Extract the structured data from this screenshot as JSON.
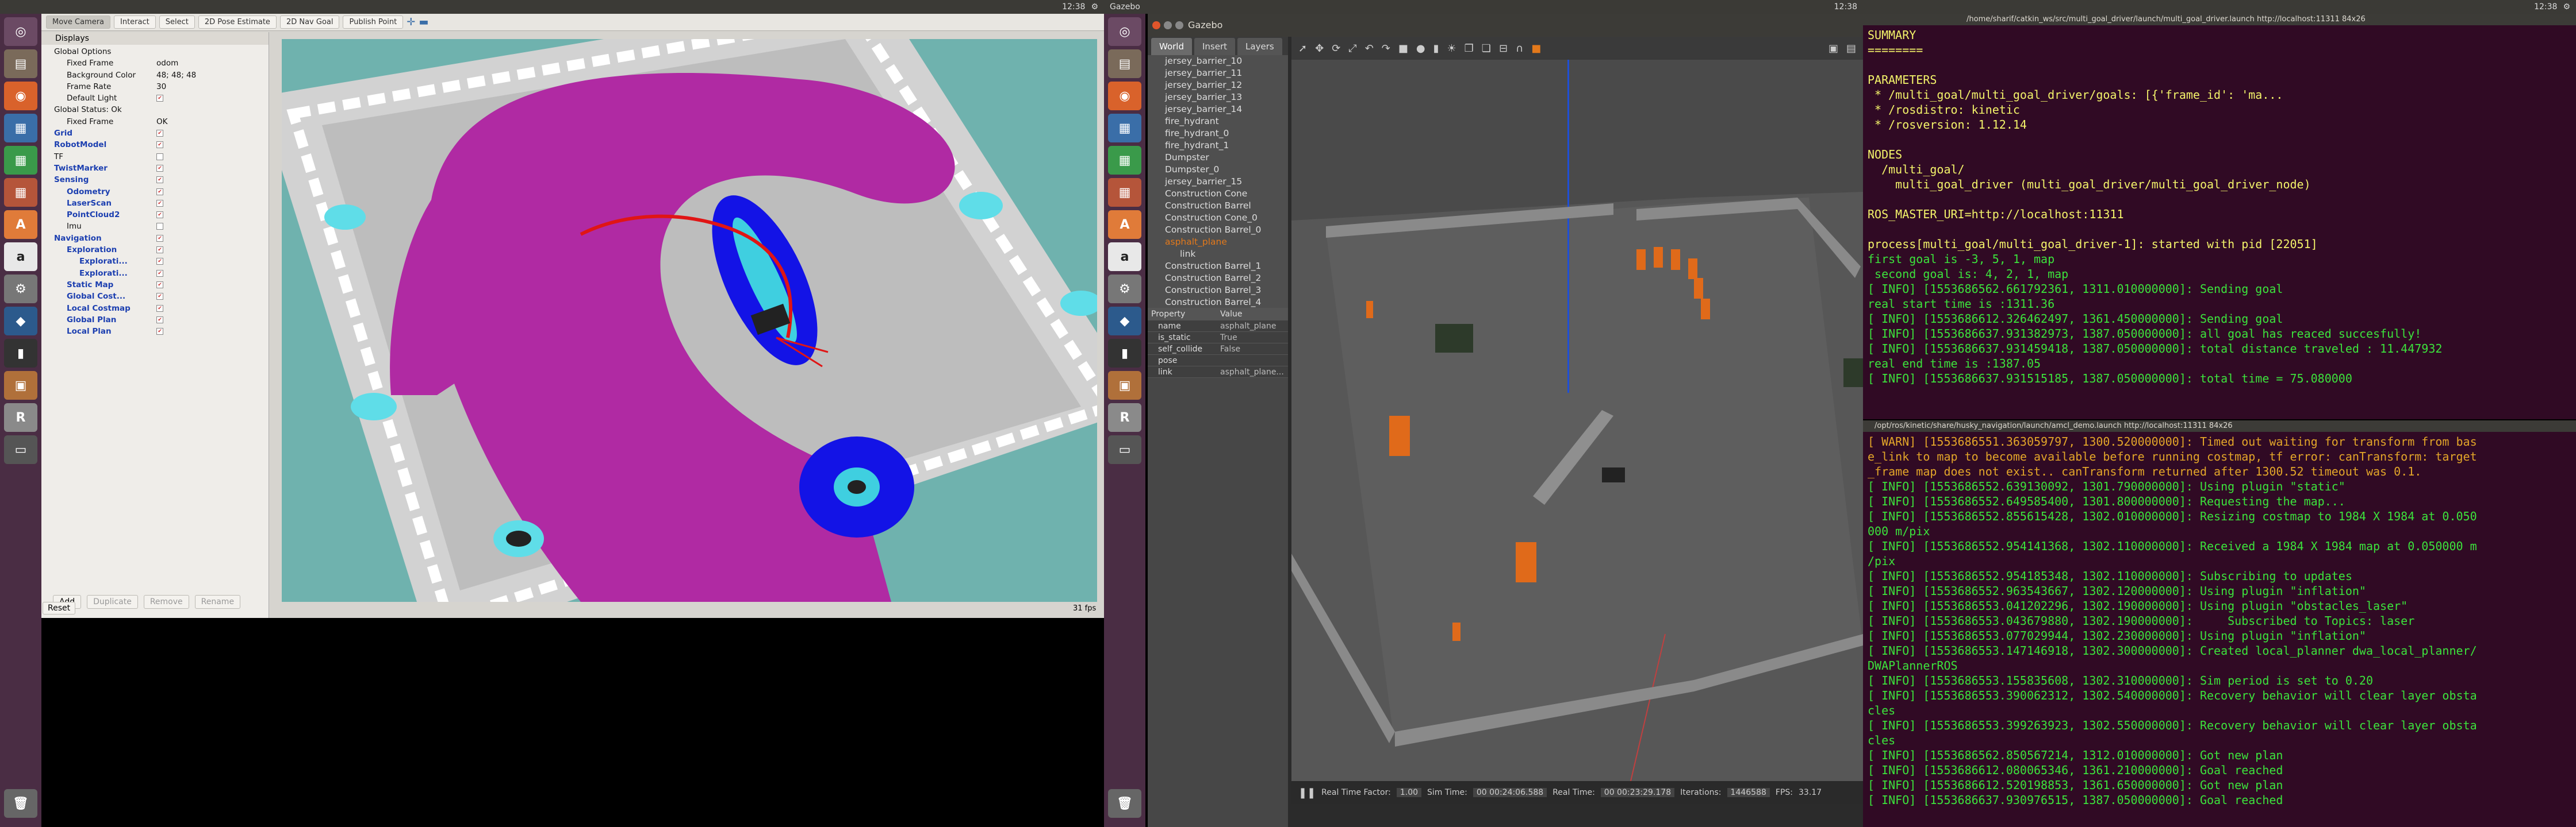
{
  "left_topbar": {
    "title": "",
    "clock": "12:38"
  },
  "mid_topbar": {
    "title": "Gazebo",
    "clock": "12:38"
  },
  "right_topbar": {
    "clock": "12:38"
  },
  "rviz": {
    "tools": [
      "Move Camera",
      "Interact",
      "Select",
      "2D Pose Estimate",
      "2D Nav Goal",
      "Publish Point"
    ],
    "displays_title": "Displays",
    "tree": [
      {
        "label": "Global Options",
        "value": "",
        "indent": 1,
        "cls": ""
      },
      {
        "label": "Fixed Frame",
        "value": "odom",
        "indent": 2,
        "cls": ""
      },
      {
        "label": "Background Color",
        "value": "48; 48; 48",
        "indent": 2,
        "cls": ""
      },
      {
        "label": "Frame Rate",
        "value": "30",
        "indent": 2,
        "cls": ""
      },
      {
        "label": "Default Light",
        "value": "",
        "indent": 2,
        "cls": "check"
      },
      {
        "label": "Global Status: Ok",
        "value": "",
        "indent": 1,
        "cls": ""
      },
      {
        "label": "Fixed Frame",
        "value": "OK",
        "indent": 2,
        "cls": ""
      },
      {
        "label": "Grid",
        "value": "",
        "indent": 1,
        "cls": "blue check"
      },
      {
        "label": "RobotModel",
        "value": "",
        "indent": 1,
        "cls": "blue check"
      },
      {
        "label": "TF",
        "value": "",
        "indent": 1,
        "cls": "box"
      },
      {
        "label": "TwistMarker",
        "value": "",
        "indent": 1,
        "cls": "blue check"
      },
      {
        "label": "Sensing",
        "value": "",
        "indent": 1,
        "cls": "blue check"
      },
      {
        "label": "Odometry",
        "value": "",
        "indent": 2,
        "cls": "blue check"
      },
      {
        "label": "LaserScan",
        "value": "",
        "indent": 2,
        "cls": "blue check"
      },
      {
        "label": "PointCloud2",
        "value": "",
        "indent": 2,
        "cls": "blue check"
      },
      {
        "label": "Imu",
        "value": "",
        "indent": 2,
        "cls": "box"
      },
      {
        "label": "Navigation",
        "value": "",
        "indent": 1,
        "cls": "blue check"
      },
      {
        "label": "Exploration",
        "value": "",
        "indent": 2,
        "cls": "blue check"
      },
      {
        "label": "Explorati...",
        "value": "",
        "indent": 3,
        "cls": "blue check"
      },
      {
        "label": "Explorati...",
        "value": "",
        "indent": 3,
        "cls": "blue check"
      },
      {
        "label": "Static Map",
        "value": "",
        "indent": 2,
        "cls": "blue check"
      },
      {
        "label": "Global Cost...",
        "value": "",
        "indent": 2,
        "cls": "blue check"
      },
      {
        "label": "Local Costmap",
        "value": "",
        "indent": 2,
        "cls": "blue check"
      },
      {
        "label": "Global Plan",
        "value": "",
        "indent": 2,
        "cls": "blue check"
      },
      {
        "label": "Local Plan",
        "value": "",
        "indent": 2,
        "cls": "blue check"
      }
    ],
    "buttons": {
      "add": "Add",
      "duplicate": "Duplicate",
      "remove": "Remove",
      "rename": "Rename",
      "reset": "Reset"
    },
    "fps": "31 fps"
  },
  "gazebo": {
    "title": "Gazebo",
    "tabs": [
      "World",
      "Insert",
      "Layers"
    ],
    "models": [
      "jersey_barrier_10",
      "jersey_barrier_11",
      "jersey_barrier_12",
      "jersey_barrier_13",
      "jersey_barrier_14",
      "fire_hydrant",
      "fire_hydrant_0",
      "fire_hydrant_1",
      "Dumpster",
      "Dumpster_0",
      "jersey_barrier_15",
      "Construction Cone",
      "Construction Barrel",
      "Construction Cone_0",
      "Construction Barrel_0",
      "Construction Barrel_1",
      "Construction Barrel_2",
      "Construction Barrel_3",
      "Construction Barrel_4"
    ],
    "selected": "asphalt_plane",
    "selected_child": "link",
    "prop_header": [
      "Property",
      "Value"
    ],
    "props": [
      {
        "k": "name",
        "v": "asphalt_plane"
      },
      {
        "k": "is_static",
        "v": "True"
      },
      {
        "k": "self_collide",
        "v": "False"
      },
      {
        "k": "pose",
        "v": ""
      },
      {
        "k": "link",
        "v": "asphalt_plane..."
      }
    ],
    "status": {
      "rtf_label": "Real Time Factor:",
      "rtf": "1.00",
      "sim_label": "Sim Time:",
      "sim": "00 00:24:06.588",
      "real_label": "Real Time:",
      "real": "00 00:23:29.178",
      "iter_label": "Iterations:",
      "iter": "1446588",
      "fps_label": "FPS:",
      "fps": "33.17"
    }
  },
  "term1": {
    "title": "/home/sharif/catkin_ws/src/multi_goal_driver/launch/multi_goal_driver.launch http://localhost:11311 84x26",
    "lines": [
      {
        "t": "SUMMARY",
        "c": "#f3f36a"
      },
      {
        "t": "========",
        "c": "#f3f36a"
      },
      {
        "t": "",
        "c": "#3ce33c"
      },
      {
        "t": "PARAMETERS",
        "c": "#f3f36a"
      },
      {
        "t": " * /multi_goal/multi_goal_driver/goals: [{'frame_id': 'ma...",
        "c": "#f3f36a"
      },
      {
        "t": " * /rosdistro: kinetic",
        "c": "#f3f36a"
      },
      {
        "t": " * /rosversion: 1.12.14",
        "c": "#f3f36a"
      },
      {
        "t": "",
        "c": "#3ce33c"
      },
      {
        "t": "NODES",
        "c": "#f3f36a"
      },
      {
        "t": "  /multi_goal/",
        "c": "#f3f36a"
      },
      {
        "t": "    multi_goal_driver (multi_goal_driver/multi_goal_driver_node)",
        "c": "#f3f36a"
      },
      {
        "t": "",
        "c": "#3ce33c"
      },
      {
        "t": "ROS_MASTER_URI=http://localhost:11311",
        "c": "#f3f36a"
      },
      {
        "t": "",
        "c": "#3ce33c"
      },
      {
        "t": "process[multi_goal/multi_goal_driver-1]: started with pid [22051]",
        "c": "#f3f36a"
      },
      {
        "t": "first goal is -3, 5, 1, map",
        "c": "#3ce33c"
      },
      {
        "t": " second goal is: 4, 2, 1, map",
        "c": "#3ce33c"
      },
      {
        "t": "[ INFO] [1553686562.661792361, 1311.010000000]: Sending goal",
        "c": "#3ce33c"
      },
      {
        "t": "real start time is :1311.36",
        "c": "#3ce33c"
      },
      {
        "t": "[ INFO] [1553686612.326462497, 1361.450000000]: Sending goal",
        "c": "#3ce33c"
      },
      {
        "t": "[ INFO] [1553686637.931382973, 1387.050000000]: all goal has reaced succesfully!",
        "c": "#3ce33c"
      },
      {
        "t": "[ INFO] [1553686637.931459418, 1387.050000000]: total distance traveled : 11.447932",
        "c": "#3ce33c"
      },
      {
        "t": "real end time is :1387.05",
        "c": "#3ce33c"
      },
      {
        "t": "[ INFO] [1553686637.931515185, 1387.050000000]: total time = 75.080000",
        "c": "#3ce33c"
      }
    ]
  },
  "term2": {
    "title": "/opt/ros/kinetic/share/husky_navigation/launch/amcl_demo.launch http://localhost:11311 84x26",
    "lines": [
      {
        "t": "[ WARN] [1553686551.363059797, 1300.520000000]: Timed out waiting for transform from bas",
        "c": "#e3a629"
      },
      {
        "t": "e_link to map to become available before running costmap, tf error: canTransform: target",
        "c": "#e3a629"
      },
      {
        "t": "_frame map does not exist.. canTransform returned after 1300.52 timeout was 0.1.",
        "c": "#e3a629"
      },
      {
        "t": "[ INFO] [1553686552.639130092, 1301.790000000]: Using plugin \"static\"",
        "c": "#3ce33c"
      },
      {
        "t": "[ INFO] [1553686552.649585400, 1301.800000000]: Requesting the map...",
        "c": "#3ce33c"
      },
      {
        "t": "[ INFO] [1553686552.855615428, 1302.010000000]: Resizing costmap to 1984 X 1984 at 0.050",
        "c": "#3ce33c"
      },
      {
        "t": "000 m/pix",
        "c": "#3ce33c"
      },
      {
        "t": "[ INFO] [1553686552.954141368, 1302.110000000]: Received a 1984 X 1984 map at 0.050000 m",
        "c": "#3ce33c"
      },
      {
        "t": "/pix",
        "c": "#3ce33c"
      },
      {
        "t": "[ INFO] [1553686552.954185348, 1302.110000000]: Subscribing to updates",
        "c": "#3ce33c"
      },
      {
        "t": "[ INFO] [1553686552.963543667, 1302.120000000]: Using plugin \"inflation\"",
        "c": "#3ce33c"
      },
      {
        "t": "[ INFO] [1553686553.041202296, 1302.190000000]: Using plugin \"obstacles_laser\"",
        "c": "#3ce33c"
      },
      {
        "t": "[ INFO] [1553686553.043679880, 1302.190000000]:     Subscribed to Topics: laser",
        "c": "#3ce33c"
      },
      {
        "t": "[ INFO] [1553686553.077029944, 1302.230000000]: Using plugin \"inflation\"",
        "c": "#3ce33c"
      },
      {
        "t": "[ INFO] [1553686553.147146918, 1302.300000000]: Created local_planner dwa_local_planner/",
        "c": "#3ce33c"
      },
      {
        "t": "DWAPlannerROS",
        "c": "#3ce33c"
      },
      {
        "t": "[ INFO] [1553686553.155835608, 1302.310000000]: Sim period is set to 0.20",
        "c": "#3ce33c"
      },
      {
        "t": "[ INFO] [1553686553.390062312, 1302.540000000]: Recovery behavior will clear layer obsta",
        "c": "#3ce33c"
      },
      {
        "t": "cles",
        "c": "#3ce33c"
      },
      {
        "t": "[ INFO] [1553686553.399263923, 1302.550000000]: Recovery behavior will clear layer obsta",
        "c": "#3ce33c"
      },
      {
        "t": "cles",
        "c": "#3ce33c"
      },
      {
        "t": "[ INFO] [1553686562.850567214, 1312.010000000]: Got new plan",
        "c": "#3ce33c"
      },
      {
        "t": "[ INFO] [1553686612.080065346, 1361.210000000]: Goal reached",
        "c": "#3ce33c"
      },
      {
        "t": "[ INFO] [1553686612.520198853, 1361.650000000]: Got new plan",
        "c": "#3ce33c"
      },
      {
        "t": "[ INFO] [1553686637.930976515, 1387.050000000]: Goal reached",
        "c": "#3ce33c"
      }
    ]
  }
}
